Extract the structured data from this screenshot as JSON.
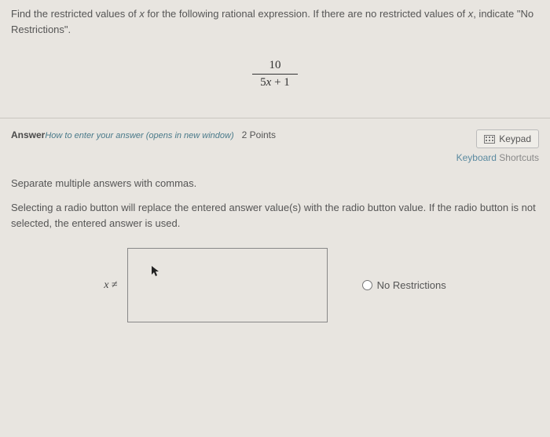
{
  "question": {
    "text_a": "Find the restricted values of ",
    "var1": "x",
    "text_b": " for the following rational expression. If there are no restricted values of ",
    "var2": "x",
    "text_c": ", indicate \"No Restrictions\"."
  },
  "expression": {
    "numerator": "10",
    "denominator": "5x + 1"
  },
  "answer_section": {
    "label": "Answer",
    "howto": "How to enter your answer (opens in new window)",
    "points": "2 Points",
    "keypad_label": "Keypad",
    "keyboard_shortcuts_a": "Keyboard ",
    "keyboard_shortcuts_b": "Shortcuts"
  },
  "instructions": {
    "separate": "Separate multiple answers with commas.",
    "radio_hint": "Selecting a radio button will replace the entered answer value(s) with the radio button value. If the radio button is not selected, the entered answer is used."
  },
  "input": {
    "prefix": "x ≠",
    "value": "",
    "radio_label": "No Restrictions"
  }
}
